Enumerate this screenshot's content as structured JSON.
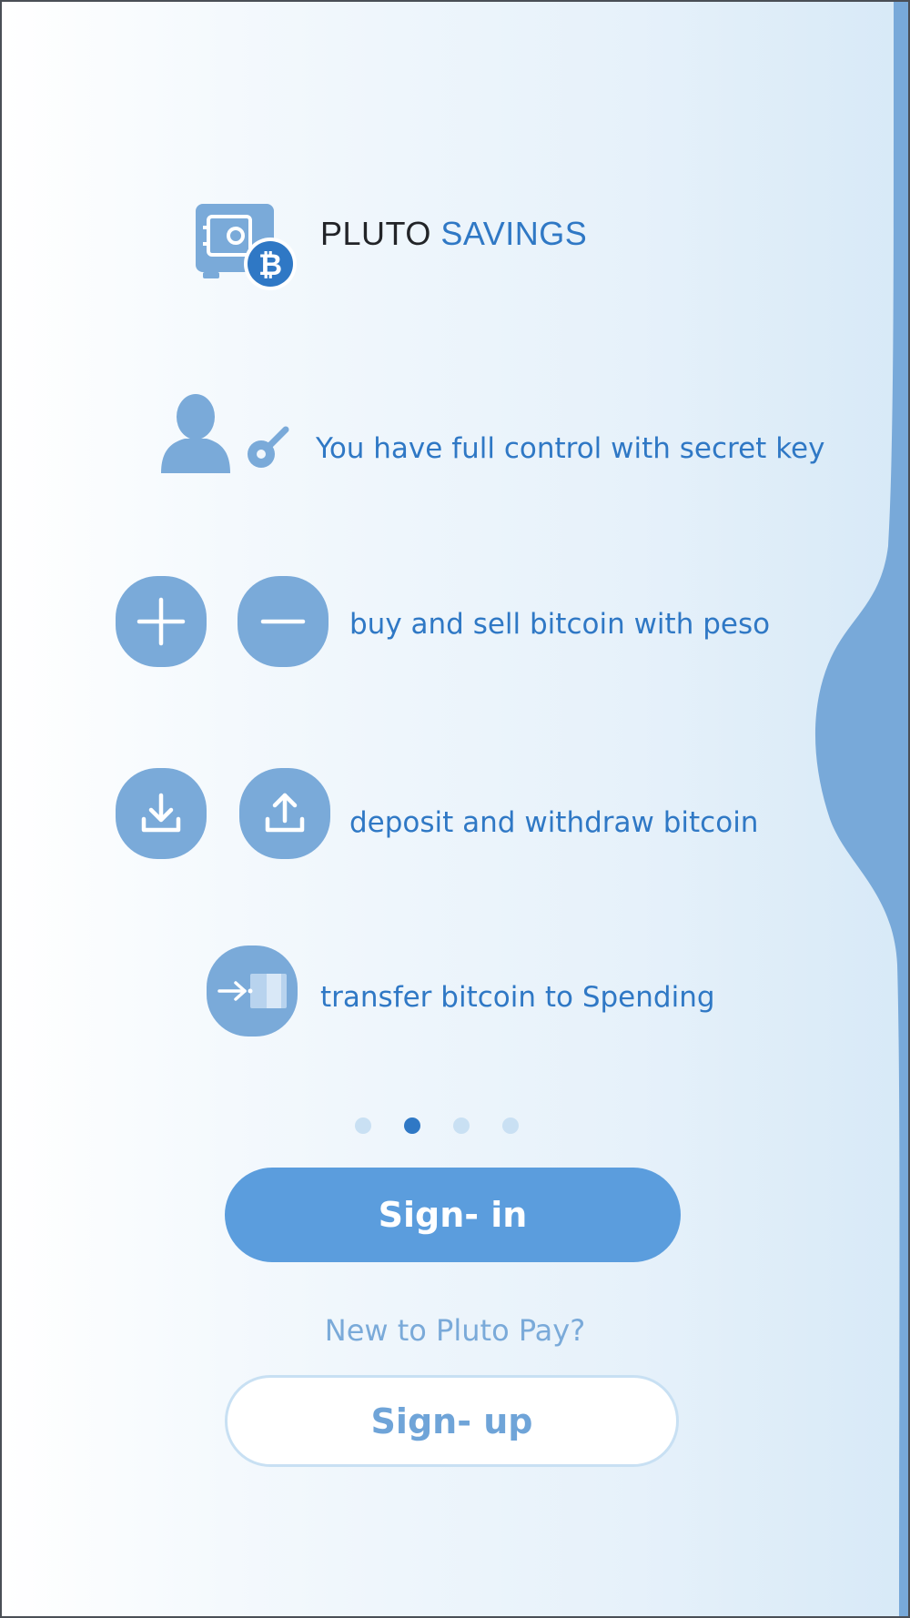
{
  "brand": {
    "word1": "PLUTO",
    "word2": "SAVINGS"
  },
  "features": [
    {
      "text": "You have full control with secret key",
      "icons": [
        "user-icon",
        "key-icon"
      ]
    },
    {
      "text": "buy and sell bitcoin with peso",
      "icons": [
        "plus-icon",
        "minus-icon"
      ]
    },
    {
      "text": "deposit and withdraw bitcoin",
      "icons": [
        "download-icon",
        "upload-icon"
      ]
    },
    {
      "text": "transfer bitcoin to Spending",
      "icons": [
        "transfer-icon"
      ]
    }
  ],
  "pager": {
    "count": 4,
    "active_index": 1
  },
  "signin": {
    "label": "Sign- in"
  },
  "new_prompt": "New to Pluto Pay?",
  "signup": {
    "label": "Sign- up"
  },
  "colors": {
    "accent": "#2f78c5",
    "button": "#5b9ddd",
    "icon_blob": "#7aaad9",
    "wave": "#78a9d9"
  }
}
